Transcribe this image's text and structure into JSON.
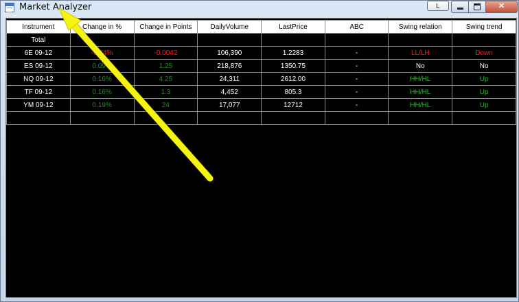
{
  "window": {
    "title": "Market Analyzer",
    "l_button": "L",
    "minimize": "minimize",
    "maximize": "maximize",
    "close_glyph": "✕"
  },
  "columns": [
    "Instrument",
    "Change in %",
    "Change in Points",
    "DailyVolume",
    "LastPrice",
    "ABC",
    "Swing relation",
    "Swing trend"
  ],
  "total_row": [
    "Total",
    "",
    "",
    "",
    "",
    "",
    "",
    ""
  ],
  "rows": [
    {
      "instrument": "6E 09-12",
      "change_pct": "-0.34%",
      "change_pts": "-0.0042",
      "volume": "106,390",
      "last_price": "1.2283",
      "abc": "-",
      "swing_relation": "LL/LH",
      "swing_trend": "Down",
      "tone": "red"
    },
    {
      "instrument": "ES 09-12",
      "change_pct": "0.09%",
      "change_pts": "1.25",
      "volume": "218,876",
      "last_price": "1350.75",
      "abc": "-",
      "swing_relation": "No",
      "swing_trend": "No",
      "tone": "white"
    },
    {
      "instrument": "NQ 09-12",
      "change_pct": "0.16%",
      "change_pts": "4.25",
      "volume": "24,311",
      "last_price": "2612.00",
      "abc": "-",
      "swing_relation": "HH/HL",
      "swing_trend": "Up",
      "tone": "green"
    },
    {
      "instrument": "TF 09-12",
      "change_pct": "0.16%",
      "change_pts": "1.3",
      "volume": "4,452",
      "last_price": "805.3",
      "abc": "-",
      "swing_relation": "HH/HL",
      "swing_trend": "Up",
      "tone": "green"
    },
    {
      "instrument": "YM 09-12",
      "change_pct": "0.19%",
      "change_pts": "24",
      "volume": "17,077",
      "last_price": "12712",
      "abc": "-",
      "swing_relation": "HH/HL",
      "swing_trend": "Up",
      "tone": "green"
    }
  ],
  "colors": {
    "background": "#000000",
    "header_bg": "#ffffff",
    "down": "#ff1e1e",
    "up": "#2cb52c",
    "annotation_arrow": "#f4f40e"
  },
  "annotation": {
    "icon": "yellow-arrow-icon"
  }
}
